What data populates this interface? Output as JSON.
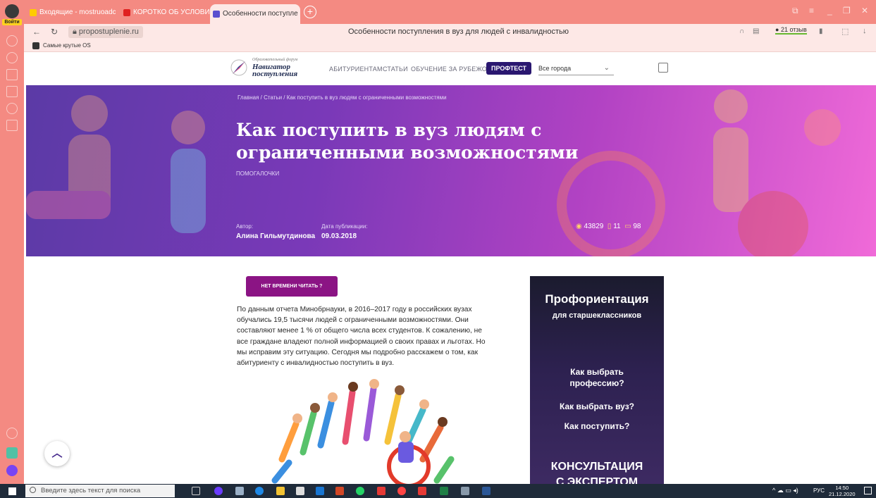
{
  "browser": {
    "login_label": "Войти",
    "tabs": [
      {
        "label": "Входящие - mostruoadc",
        "icon_color": "#ffcc00"
      },
      {
        "label": "КОРОТКО ОБ УСЛОВИЯХ",
        "icon_color": "#e02020"
      },
      {
        "label": "Особенности поступле ×",
        "icon_color": "#5a4fcf",
        "active": true
      }
    ],
    "url": "propostuplenie.ru",
    "page_title": "Особенности поступления в вуз для людей с инвалидностью",
    "reviews": "21 отзыв",
    "bookmark": "Самые крутые OS"
  },
  "site": {
    "logo_small": "Образовательный форум",
    "logo_big": "Навигатор поступления",
    "nav": [
      "АБИТУРИЕНТАМ",
      "СТАТЬИ",
      "ОБУЧЕНИЕ ЗА РУБЕЖОМ"
    ],
    "proftest": "ПРОФТЕСТ",
    "city": "Все города"
  },
  "hero": {
    "breadcrumb": "Главная / Статьи / Как поступить в вуз людям с ограниченными возможностями",
    "title": "Как поступить в вуз людям с ограниченными возможностями",
    "tag": "помогалочки",
    "author_label": "Автор:",
    "author": "Алина Гильмутдинова",
    "date_label": "Дата публикации:",
    "date": "09.03.2018",
    "views": "43829",
    "bookmarks": "11",
    "comments": "98"
  },
  "content": {
    "no_time_button": "НЕТ ВРЕМЕНИ ЧИТАТЬ ?",
    "paragraph": "По данным отчета Минобрнауки, в 2016–2017 году в российских вузах обучались 19,5 тысячи людей с ограниченными возможностями. Они составляют менее 1 % от общего числа всех студентов. К сожалению, не все граждане владеют полной информацией о своих правах и льготах. Но мы исправим эту ситуацию. Сегодня мы подробно расскажем о том, как абитуриенту с инвалидностью поступить в вуз."
  },
  "ad": {
    "title": "Профориентация",
    "subtitle": "для старшеклассников",
    "q1": "Как выбрать профессию?",
    "q2": "Как выбрать вуз?",
    "q3": "Как поступить?",
    "cta1": "КОНСУЛЬТАЦИЯ",
    "cta2": "С ЭКСПЕРТОМ"
  },
  "taskbar": {
    "search_placeholder": "Введите здесь текст для поиска",
    "lang": "РУС",
    "time": "14:50",
    "date": "21.12.2020"
  }
}
